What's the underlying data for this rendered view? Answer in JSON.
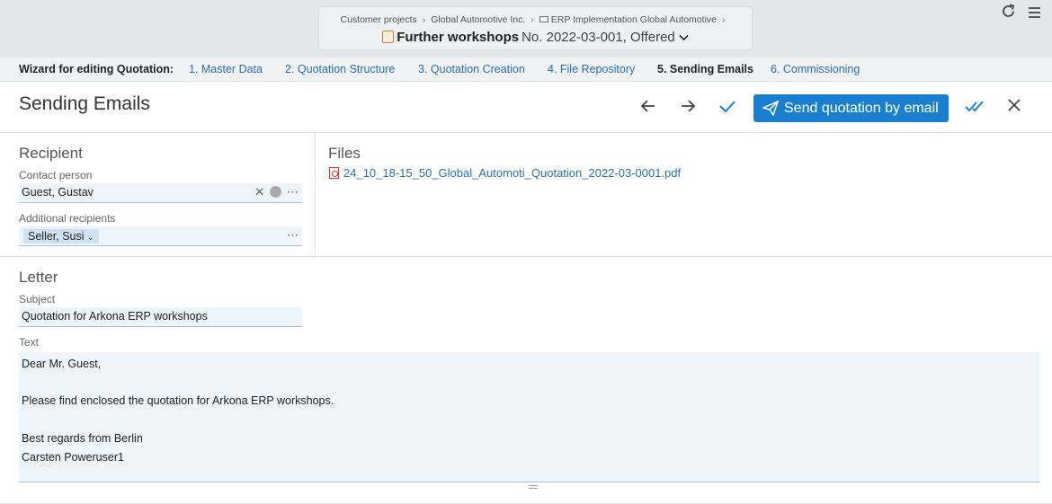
{
  "header": {
    "breadcrumbs": [
      "Customer projects",
      "Global Automotive Inc.",
      "ERP Implementation Global Automotive"
    ],
    "title_main": "Further workshops",
    "title_sub": "No. 2022-03-001, Offered"
  },
  "top_actions": {
    "refresh_icon": "refresh-icon",
    "menu_icon": "hamburger-menu-icon"
  },
  "wizard": {
    "label": "Wizard for editing Quotation:",
    "steps": [
      {
        "label": "1. Master Data",
        "active": false
      },
      {
        "label": "2. Quotation Structure",
        "active": false
      },
      {
        "label": "3. Quotation Creation",
        "active": false
      },
      {
        "label": "4. File Repository",
        "active": false
      },
      {
        "label": "5. Sending Emails",
        "active": true
      },
      {
        "label": "6. Commissioning",
        "active": false
      }
    ]
  },
  "page": {
    "title": "Sending Emails",
    "send_button": "Send quotation by email"
  },
  "recipient": {
    "title": "Recipient",
    "contact_label": "Contact person",
    "contact_value": "Guest, Gustav",
    "additional_label": "Additional recipients",
    "additional_value": "Seller, Susi"
  },
  "files": {
    "title": "Files",
    "items": [
      "24_10_18-15_50_Global_Automoti_Quotation_2022-03-0001.pdf"
    ]
  },
  "letter": {
    "title": "Letter",
    "subject_label": "Subject",
    "subject_value": "Quotation for Arkona ERP workshops",
    "text_label": "Text",
    "text_value": "Dear Mr. Guest,\n\nPlease find enclosed the quotation for Arkona ERP workshops.\n\nBest regards from Berlin\nCarsten Poweruser1"
  },
  "colors": {
    "accent": "#1a7fcf",
    "link": "#2b6fb0",
    "field_bg": "#edf5fb"
  }
}
